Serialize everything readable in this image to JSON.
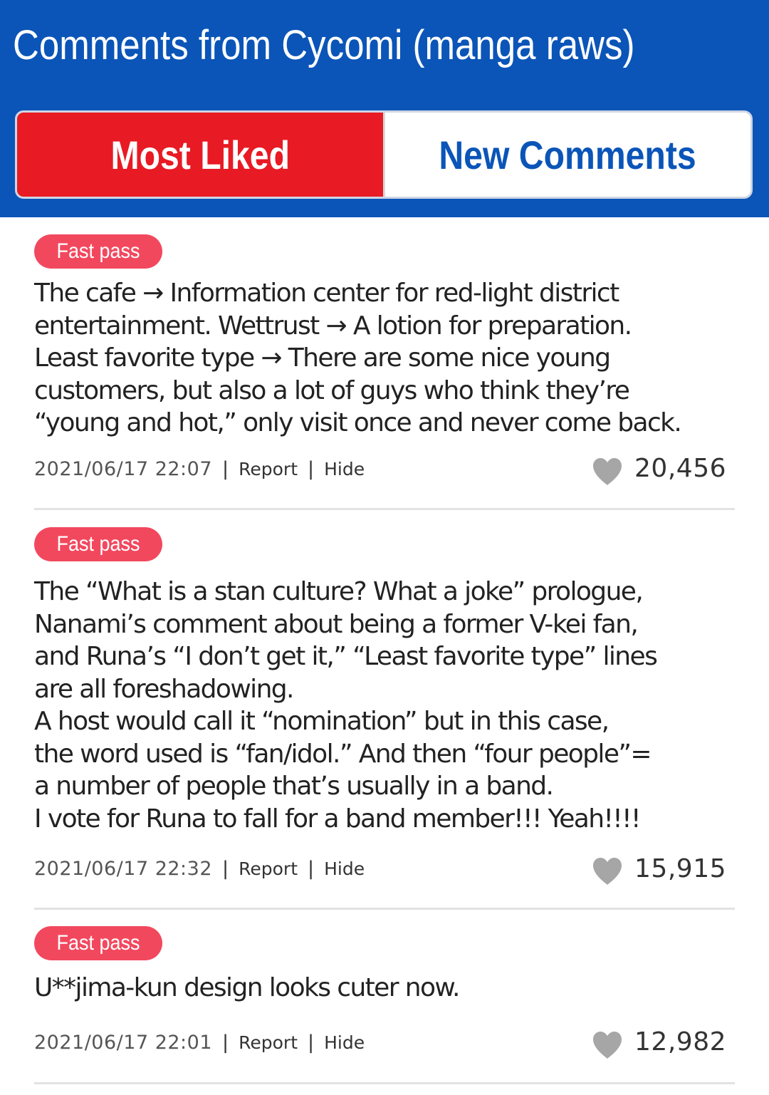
{
  "header": {
    "title": "Comments from Cycomi (manga raws)"
  },
  "tabs": [
    {
      "label": "Most Liked",
      "active": true
    },
    {
      "label": "New Comments",
      "active": false
    }
  ],
  "comments": [
    {
      "badge": "Fast pass",
      "text": "The cafe → Information center for red-light district\nentertainment. Wettrust → A lotion for preparation.\nLeast favorite type → There are some nice young\ncustomers, but also a lot of guys who think they’re\n“young and hot,” only visit once and never come back.",
      "date": "2021/06/17 22:07",
      "report": "Report",
      "hide": "Hide",
      "likes": "20,456"
    },
    {
      "badge": "Fast pass",
      "text": "The “What is a stan culture? What a joke” prologue,\nNanami’s comment about being a former V-kei fan,\nand Runa’s “I don’t get it,” “Least favorite type” lines\nare all foreshadowing.\nA host would call it “nomination” but in this case,\nthe word used is “fan/idol.” And then “four people”=\na number of people that’s usually in a band.\nI vote for Runa to fall for a band member!!! Yeah!!!!",
      "date": "2021/06/17 22:32",
      "report": "Report",
      "hide": "Hide",
      "likes": "15,915"
    },
    {
      "badge": "Fast pass",
      "text": "U**jima-kun design looks cuter now.",
      "date": "2021/06/17 22:01",
      "report": "Report",
      "hide": "Hide",
      "likes": "12,982"
    }
  ],
  "colors": {
    "header_bg": "#0b55b8",
    "active_tab_bg": "#e81a24",
    "badge_bg": "#f2485e",
    "heart": "#a6a6a6"
  },
  "icons": {
    "like": "heart-icon"
  }
}
